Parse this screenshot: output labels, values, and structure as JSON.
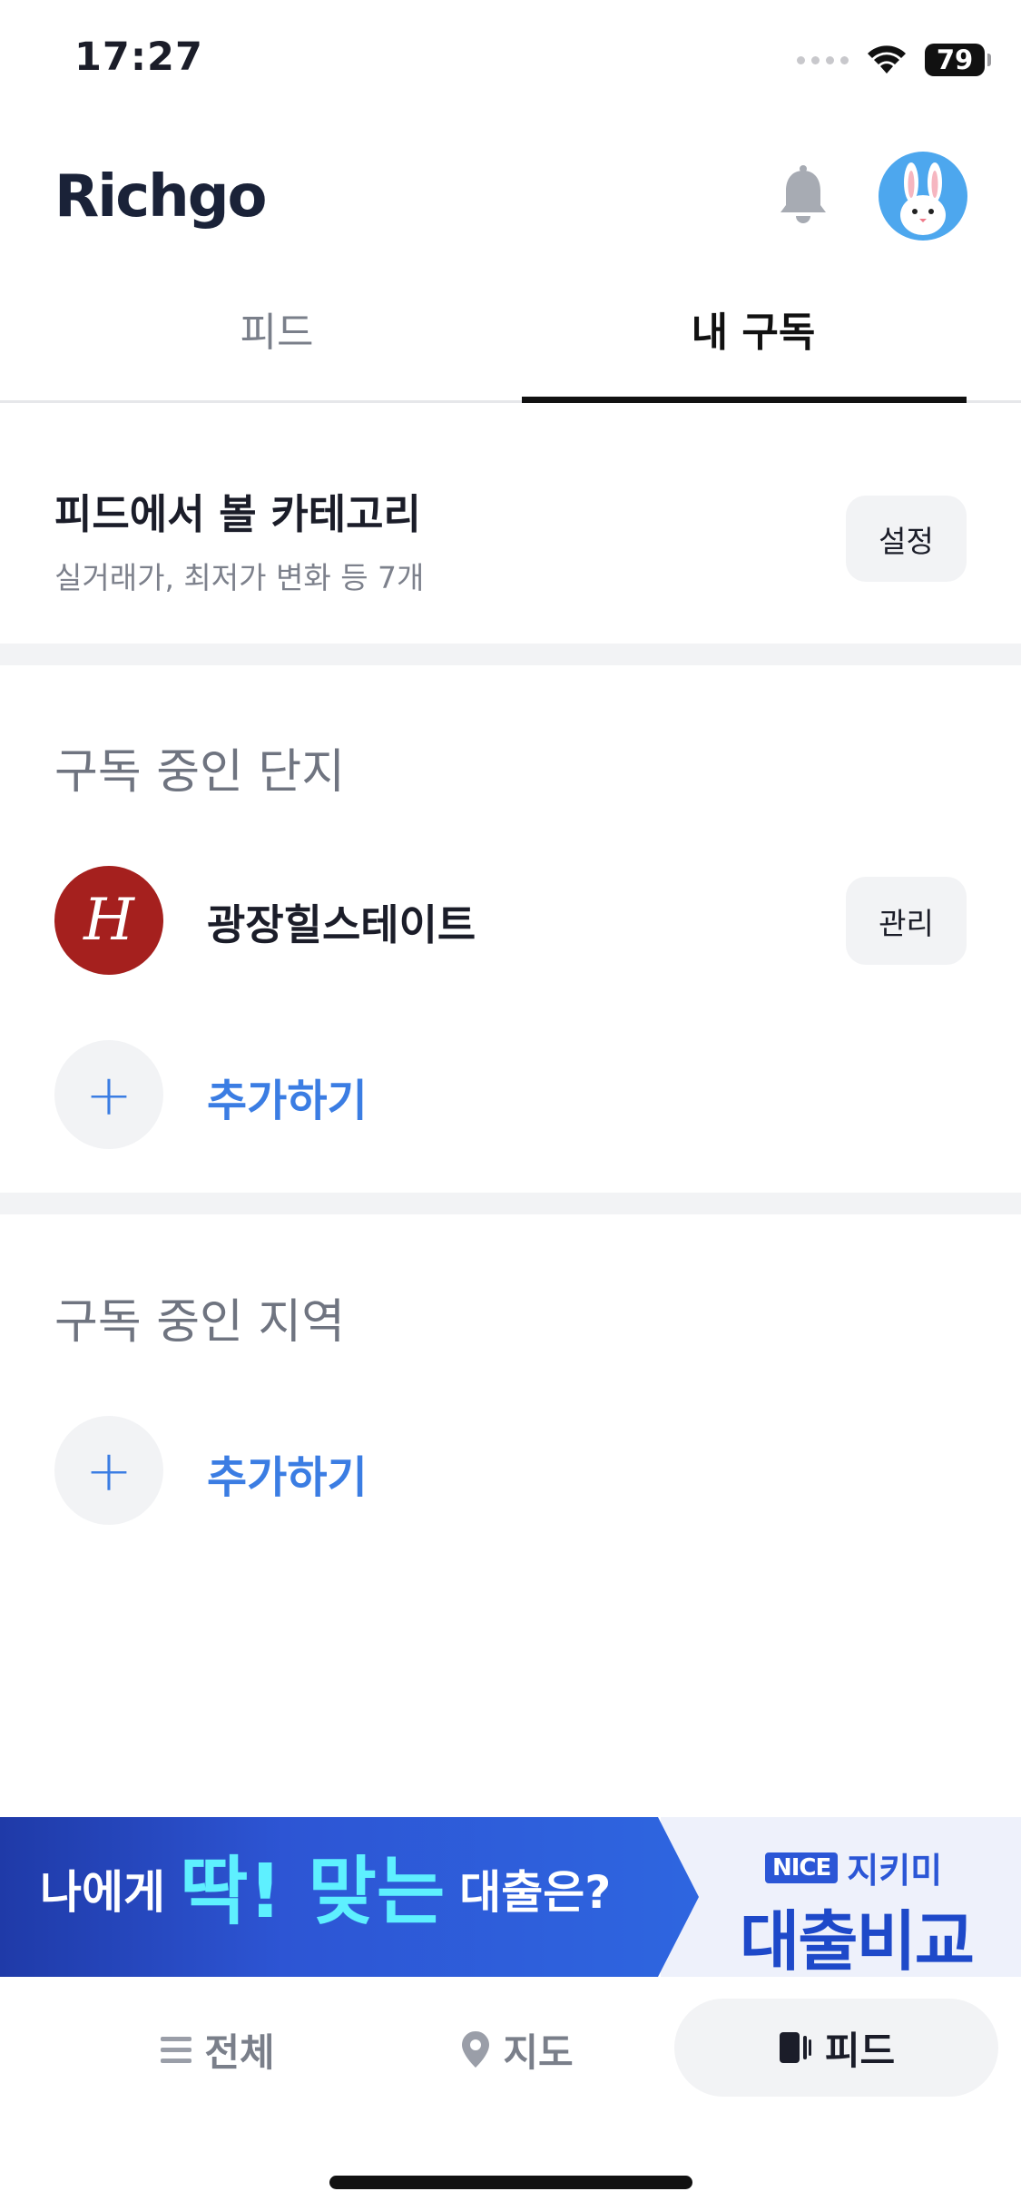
{
  "status_bar": {
    "time": "17:27",
    "battery": "79"
  },
  "header": {
    "logo": "Richgo",
    "bell_icon": "bell-icon",
    "avatar_icon": "rabbit-avatar"
  },
  "tabs": [
    {
      "label": "피드",
      "active": false
    },
    {
      "label": "내 구독",
      "active": true
    }
  ],
  "category": {
    "title": "피드에서 볼 카테고리",
    "subtitle": "실거래가, 최저가 변화 등 7개",
    "settings_label": "설정"
  },
  "complexes": {
    "title": "구독 중인 단지",
    "items": [
      {
        "name": "광장힐스테이트",
        "manage_label": "관리",
        "logo_letter": "H"
      }
    ],
    "add_label": "추가하기"
  },
  "regions": {
    "title": "구독 중인 지역",
    "add_label": "추가하기"
  },
  "banner": {
    "text_1": "나에게",
    "text_2": "딱! 맞는",
    "text_3": "대출은?",
    "brand_badge": "NICE",
    "brand_name": "지키미",
    "cta": "대출비교"
  },
  "nav": [
    {
      "label": "전체",
      "icon": "menu-icon",
      "active": false
    },
    {
      "label": "지도",
      "icon": "map-pin-icon",
      "active": false
    },
    {
      "label": "피드",
      "icon": "feed-icon",
      "active": true
    }
  ],
  "colors": {
    "accent": "#3b7de3",
    "brand_red": "#a5201e",
    "banner_blue": "#2d55d4"
  }
}
